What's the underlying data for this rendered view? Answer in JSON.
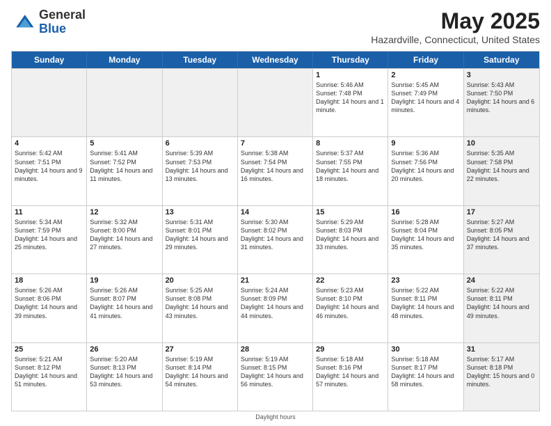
{
  "logo": {
    "general": "General",
    "blue": "Blue"
  },
  "title": {
    "month": "May 2025",
    "location": "Hazardville, Connecticut, United States"
  },
  "header_days": [
    "Sunday",
    "Monday",
    "Tuesday",
    "Wednesday",
    "Thursday",
    "Friday",
    "Saturday"
  ],
  "footer": {
    "daylight": "Daylight hours"
  },
  "weeks": [
    [
      {
        "day": "",
        "text": "",
        "shaded": true
      },
      {
        "day": "",
        "text": "",
        "shaded": true
      },
      {
        "day": "",
        "text": "",
        "shaded": true
      },
      {
        "day": "",
        "text": "",
        "shaded": true
      },
      {
        "day": "1",
        "text": "Sunrise: 5:46 AM\nSunset: 7:48 PM\nDaylight: 14 hours and 1 minute.",
        "shaded": false
      },
      {
        "day": "2",
        "text": "Sunrise: 5:45 AM\nSunset: 7:49 PM\nDaylight: 14 hours and 4 minutes.",
        "shaded": false
      },
      {
        "day": "3",
        "text": "Sunrise: 5:43 AM\nSunset: 7:50 PM\nDaylight: 14 hours and 6 minutes.",
        "shaded": true
      }
    ],
    [
      {
        "day": "4",
        "text": "Sunrise: 5:42 AM\nSunset: 7:51 PM\nDaylight: 14 hours and 9 minutes.",
        "shaded": false
      },
      {
        "day": "5",
        "text": "Sunrise: 5:41 AM\nSunset: 7:52 PM\nDaylight: 14 hours and 11 minutes.",
        "shaded": false
      },
      {
        "day": "6",
        "text": "Sunrise: 5:39 AM\nSunset: 7:53 PM\nDaylight: 14 hours and 13 minutes.",
        "shaded": false
      },
      {
        "day": "7",
        "text": "Sunrise: 5:38 AM\nSunset: 7:54 PM\nDaylight: 14 hours and 16 minutes.",
        "shaded": false
      },
      {
        "day": "8",
        "text": "Sunrise: 5:37 AM\nSunset: 7:55 PM\nDaylight: 14 hours and 18 minutes.",
        "shaded": false
      },
      {
        "day": "9",
        "text": "Sunrise: 5:36 AM\nSunset: 7:56 PM\nDaylight: 14 hours and 20 minutes.",
        "shaded": false
      },
      {
        "day": "10",
        "text": "Sunrise: 5:35 AM\nSunset: 7:58 PM\nDaylight: 14 hours and 22 minutes.",
        "shaded": true
      }
    ],
    [
      {
        "day": "11",
        "text": "Sunrise: 5:34 AM\nSunset: 7:59 PM\nDaylight: 14 hours and 25 minutes.",
        "shaded": false
      },
      {
        "day": "12",
        "text": "Sunrise: 5:32 AM\nSunset: 8:00 PM\nDaylight: 14 hours and 27 minutes.",
        "shaded": false
      },
      {
        "day": "13",
        "text": "Sunrise: 5:31 AM\nSunset: 8:01 PM\nDaylight: 14 hours and 29 minutes.",
        "shaded": false
      },
      {
        "day": "14",
        "text": "Sunrise: 5:30 AM\nSunset: 8:02 PM\nDaylight: 14 hours and 31 minutes.",
        "shaded": false
      },
      {
        "day": "15",
        "text": "Sunrise: 5:29 AM\nSunset: 8:03 PM\nDaylight: 14 hours and 33 minutes.",
        "shaded": false
      },
      {
        "day": "16",
        "text": "Sunrise: 5:28 AM\nSunset: 8:04 PM\nDaylight: 14 hours and 35 minutes.",
        "shaded": false
      },
      {
        "day": "17",
        "text": "Sunrise: 5:27 AM\nSunset: 8:05 PM\nDaylight: 14 hours and 37 minutes.",
        "shaded": true
      }
    ],
    [
      {
        "day": "18",
        "text": "Sunrise: 5:26 AM\nSunset: 8:06 PM\nDaylight: 14 hours and 39 minutes.",
        "shaded": false
      },
      {
        "day": "19",
        "text": "Sunrise: 5:26 AM\nSunset: 8:07 PM\nDaylight: 14 hours and 41 minutes.",
        "shaded": false
      },
      {
        "day": "20",
        "text": "Sunrise: 5:25 AM\nSunset: 8:08 PM\nDaylight: 14 hours and 43 minutes.",
        "shaded": false
      },
      {
        "day": "21",
        "text": "Sunrise: 5:24 AM\nSunset: 8:09 PM\nDaylight: 14 hours and 44 minutes.",
        "shaded": false
      },
      {
        "day": "22",
        "text": "Sunrise: 5:23 AM\nSunset: 8:10 PM\nDaylight: 14 hours and 46 minutes.",
        "shaded": false
      },
      {
        "day": "23",
        "text": "Sunrise: 5:22 AM\nSunset: 8:11 PM\nDaylight: 14 hours and 48 minutes.",
        "shaded": false
      },
      {
        "day": "24",
        "text": "Sunrise: 5:22 AM\nSunset: 8:11 PM\nDaylight: 14 hours and 49 minutes.",
        "shaded": true
      }
    ],
    [
      {
        "day": "25",
        "text": "Sunrise: 5:21 AM\nSunset: 8:12 PM\nDaylight: 14 hours and 51 minutes.",
        "shaded": false
      },
      {
        "day": "26",
        "text": "Sunrise: 5:20 AM\nSunset: 8:13 PM\nDaylight: 14 hours and 53 minutes.",
        "shaded": false
      },
      {
        "day": "27",
        "text": "Sunrise: 5:19 AM\nSunset: 8:14 PM\nDaylight: 14 hours and 54 minutes.",
        "shaded": false
      },
      {
        "day": "28",
        "text": "Sunrise: 5:19 AM\nSunset: 8:15 PM\nDaylight: 14 hours and 56 minutes.",
        "shaded": false
      },
      {
        "day": "29",
        "text": "Sunrise: 5:18 AM\nSunset: 8:16 PM\nDaylight: 14 hours and 57 minutes.",
        "shaded": false
      },
      {
        "day": "30",
        "text": "Sunrise: 5:18 AM\nSunset: 8:17 PM\nDaylight: 14 hours and 58 minutes.",
        "shaded": false
      },
      {
        "day": "31",
        "text": "Sunrise: 5:17 AM\nSunset: 8:18 PM\nDaylight: 15 hours and 0 minutes.",
        "shaded": true
      }
    ]
  ]
}
